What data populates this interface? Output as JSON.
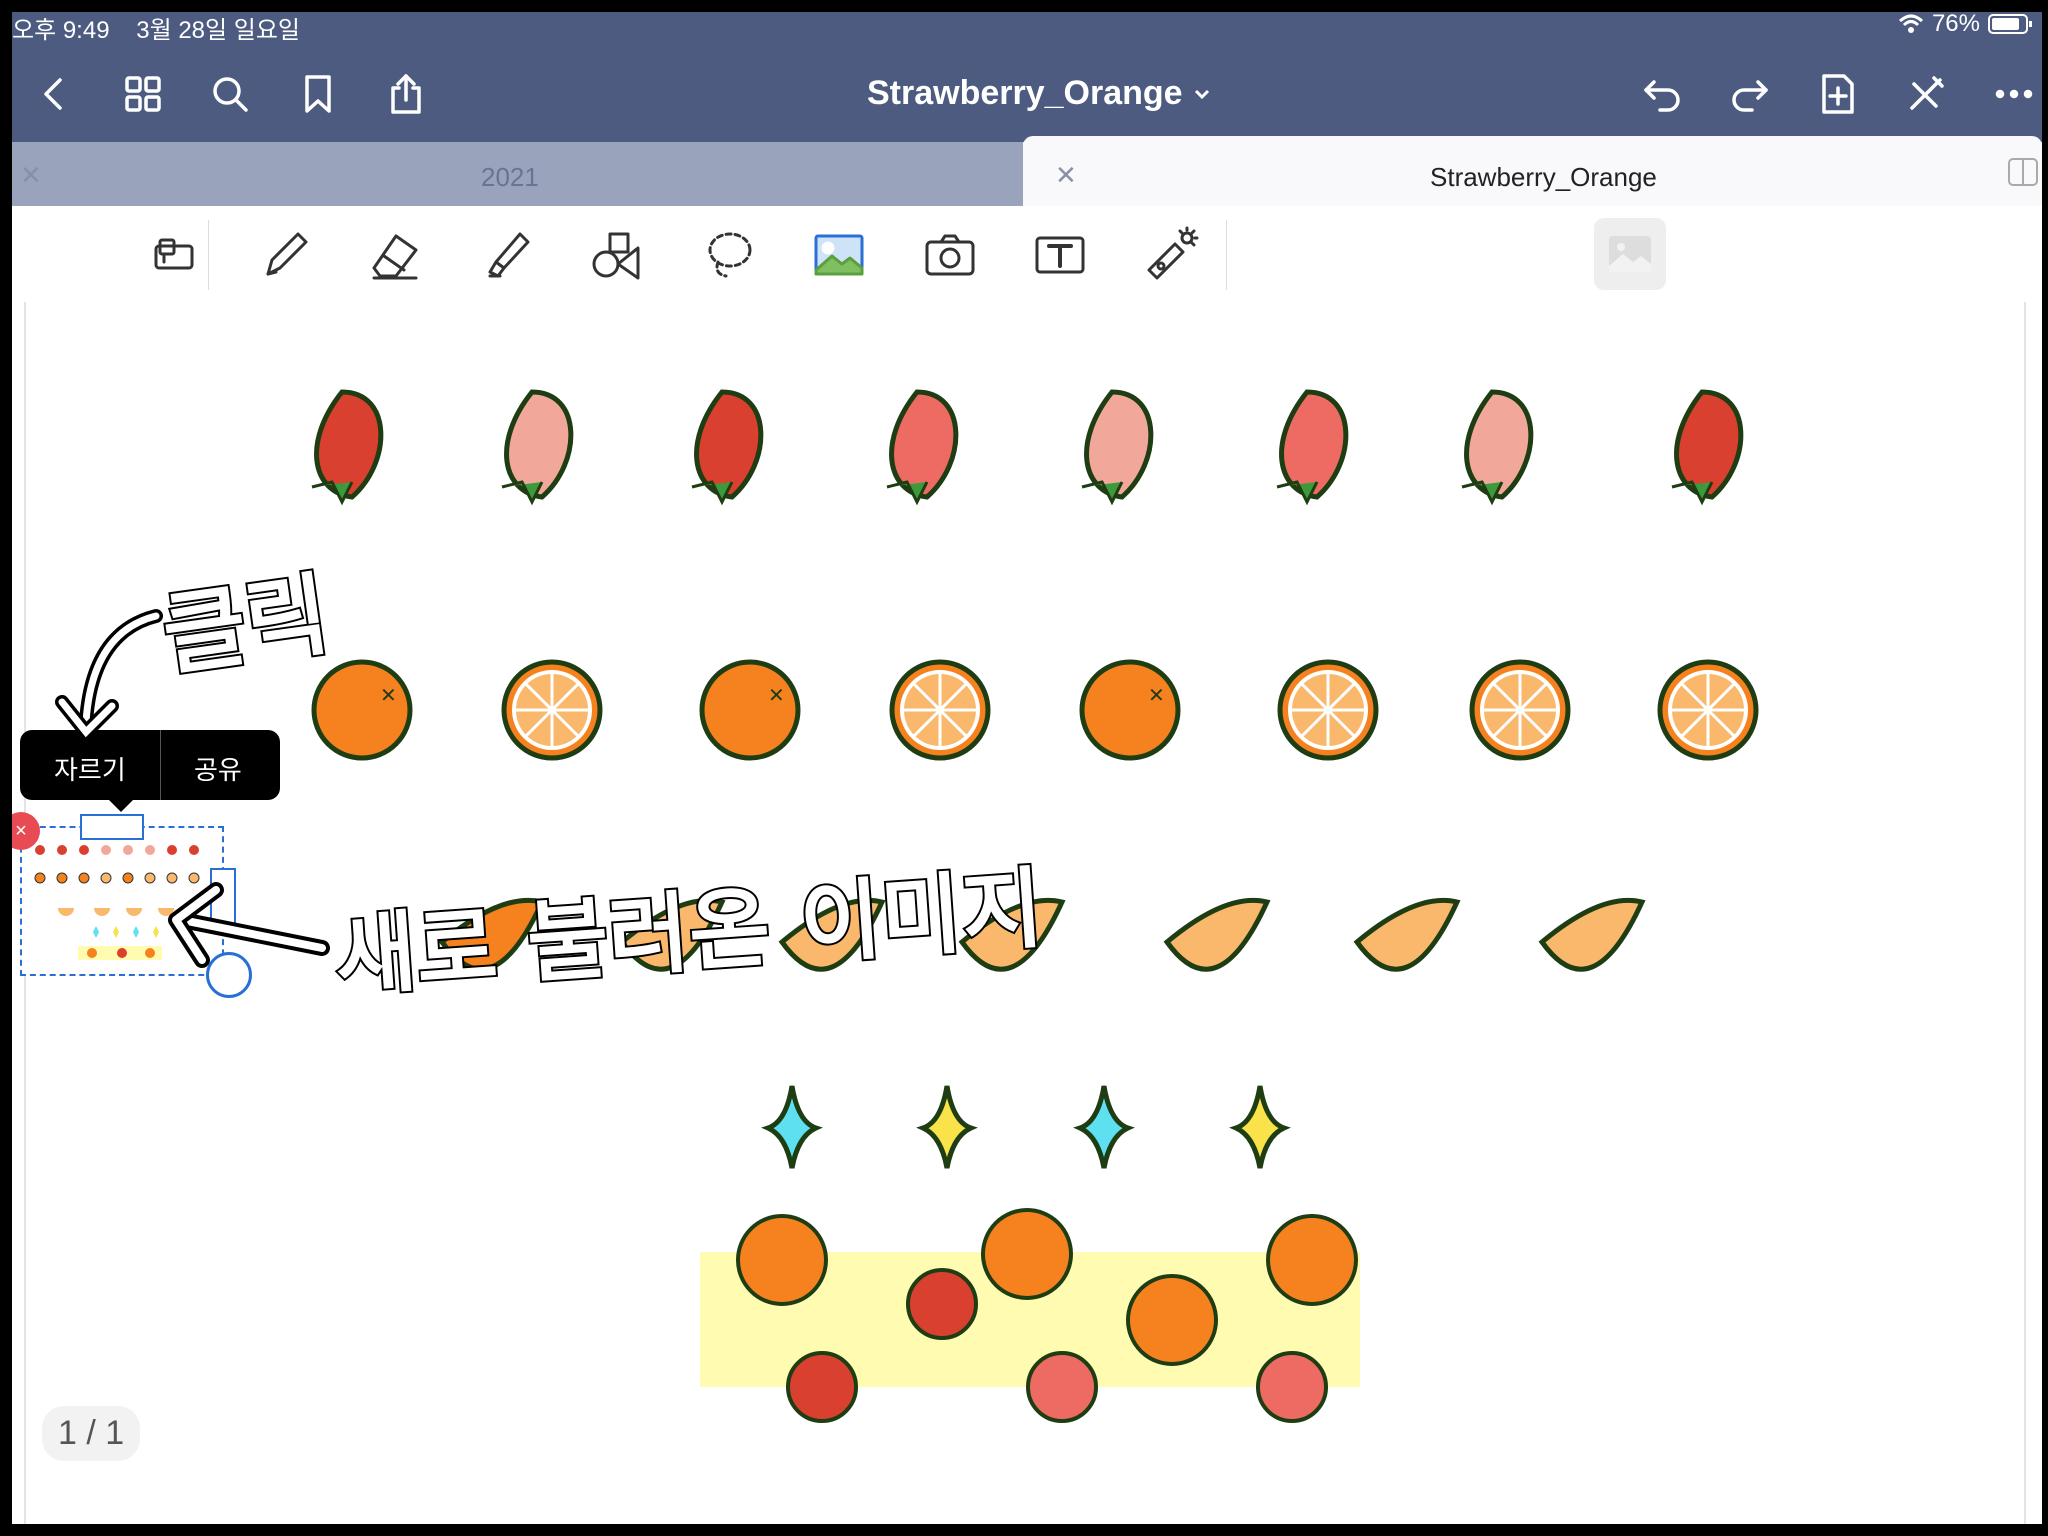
{
  "status_bar": {
    "time": "오후 9:49",
    "date": "3월 28일 일요일",
    "battery": "76%",
    "battery_level": 0.76
  },
  "nav": {
    "title": "Strawberry_Orange",
    "left_icons": [
      "back-icon",
      "grid-icon",
      "search-icon",
      "bookmark-icon",
      "share-icon"
    ],
    "right_icons": [
      "undo-icon",
      "redo-icon",
      "add-page-icon",
      "close-pen-icon",
      "more-icon"
    ]
  },
  "tabs": [
    {
      "label": "2021",
      "active": false
    },
    {
      "label": "Strawberry_Orange",
      "active": true
    }
  ],
  "toolbar": {
    "tools": [
      "zoom-window-tool",
      "pen-tool",
      "eraser-tool",
      "highlighter-tool",
      "shapes-tool",
      "lasso-tool",
      "image-tool",
      "camera-tool",
      "text-tool",
      "laser-pointer-tool"
    ],
    "active_tool": "image-tool"
  },
  "context_menu": {
    "items": [
      "자르기",
      "공유"
    ]
  },
  "annotations": {
    "click": "클릭",
    "new_image": "새로 불러온 이미지"
  },
  "page_indicator": "1 / 1",
  "colors": {
    "navbar": "#4d5b80",
    "tab_inactive": "#9aa3bc",
    "strawberry": "#d9402f",
    "pink_strawberry": "#f1a79a",
    "orange": "#f5821f",
    "melon": "#f9b86b",
    "sparkle_blue": "#5ee0f0",
    "sparkle_yellow": "#f9e24a",
    "tape_bg": "#fffbb0"
  }
}
